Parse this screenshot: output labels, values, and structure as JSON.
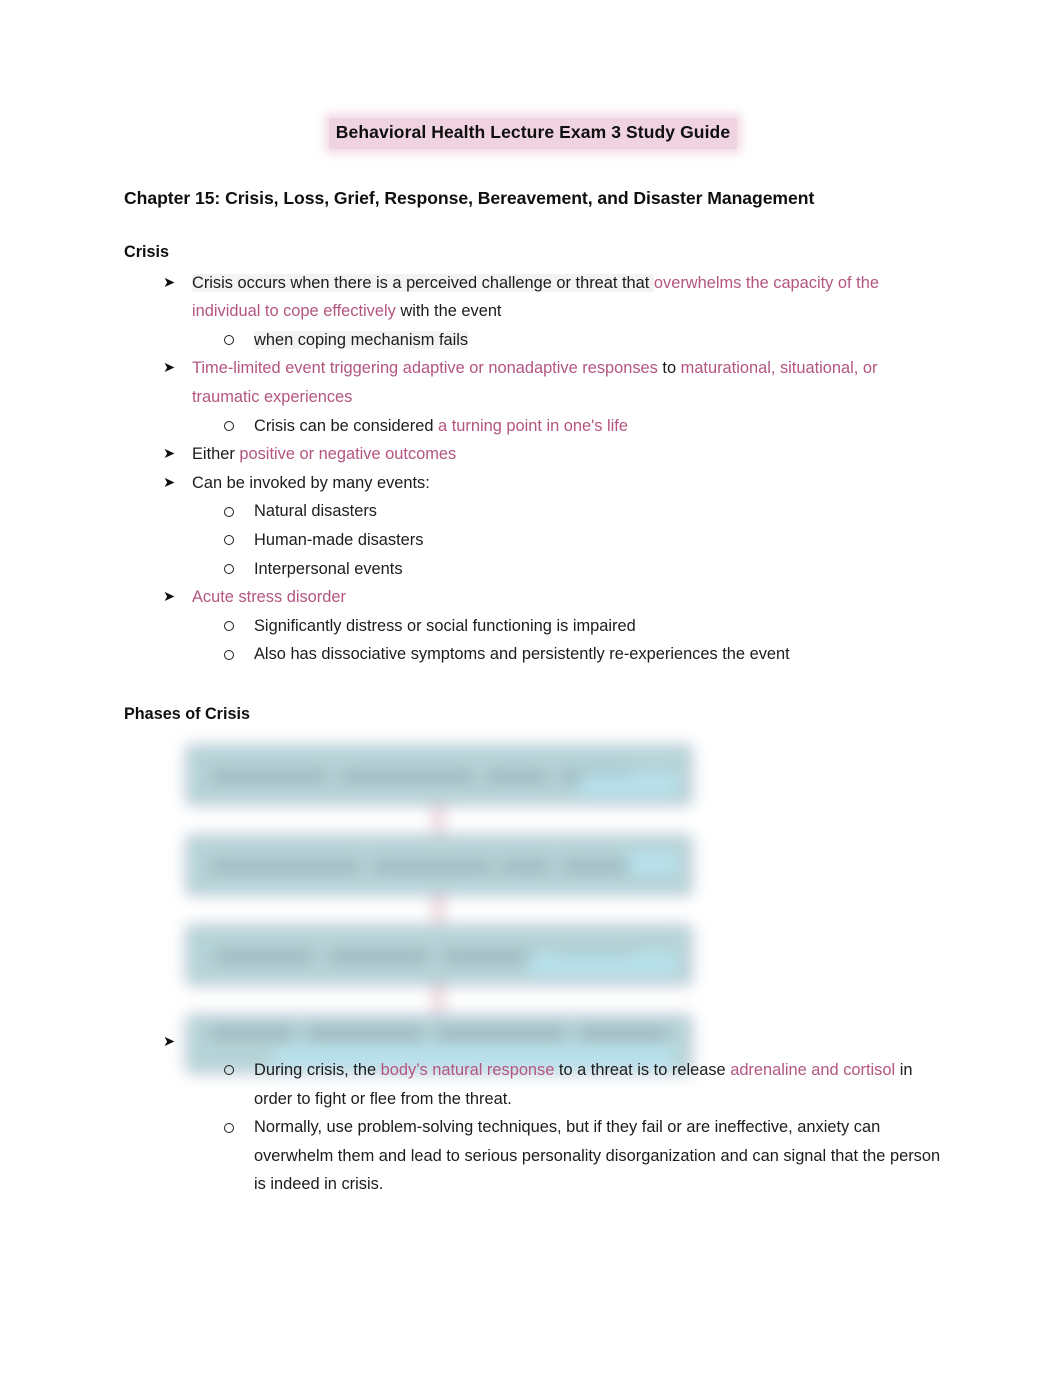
{
  "document": {
    "title": "Behavioral Health Lecture Exam 3 Study Guide",
    "chapter_heading": "Chapter 15: Crisis, Loss, Grief, Response, Bereavement, and Disaster Management"
  },
  "colors": {
    "highlight_pink": "#b35580",
    "title_highlight_bg": "#f0d3e0",
    "diagram_box_fill": "#b3d3d7",
    "diagram_box_border": "#b9bed2",
    "diagram_connector": "#c98c9c",
    "body_text": "#1c1c1c"
  },
  "bullets": {
    "arrow": "➤",
    "circle": "○"
  },
  "sections": [
    {
      "heading": "Crisis",
      "items": [
        {
          "level": 1,
          "runs": [
            {
              "text": "Crisis occurs when there is a perceived challenge or threat that ",
              "style": "dark"
            },
            {
              "text": "overwhelms the capacity of the individual to cope effectively",
              "style": "pink"
            },
            {
              "text": " with the event",
              "style": "dark"
            }
          ]
        },
        {
          "level": 2,
          "runs": [
            {
              "text": "when coping mechanism fails",
              "style": "dark"
            }
          ]
        },
        {
          "level": 1,
          "runs": [
            {
              "text": "Time-limited event triggering adaptive or nonadaptive responses",
              "style": "pink"
            },
            {
              "text": " to",
              "style": "dark"
            },
            {
              "text": " maturational, situational, or traumatic experiences",
              "style": "pink"
            }
          ]
        },
        {
          "level": 2,
          "runs": [
            {
              "text": "Crisis can be considered ",
              "style": "dark"
            },
            {
              "text": "a turning point in one's life",
              "style": "pink"
            }
          ]
        },
        {
          "level": 1,
          "runs": [
            {
              "text": "Either ",
              "style": "dark"
            },
            {
              "text": "positive or negative outcomes",
              "style": "pink"
            }
          ]
        },
        {
          "level": 1,
          "runs": [
            {
              "text": "Can be invoked by many events:",
              "style": "dark"
            }
          ]
        },
        {
          "level": 2,
          "runs": [
            {
              "text": "Natural disasters",
              "style": "dark"
            }
          ]
        },
        {
          "level": 2,
          "runs": [
            {
              "text": "Human-made disasters",
              "style": "dark"
            }
          ]
        },
        {
          "level": 2,
          "runs": [
            {
              "text": "Interpersonal events",
              "style": "dark"
            }
          ]
        },
        {
          "level": 1,
          "runs": [
            {
              "text": "Acute stress disorder",
              "style": "pink"
            }
          ]
        },
        {
          "level": 2,
          "runs": [
            {
              "text": "Significantly distress or social functioning is impaired",
              "style": "dark"
            }
          ]
        },
        {
          "level": 2,
          "runs": [
            {
              "text": "Also has dissociative symptoms and persistently re-experiences the event",
              "style": "dark"
            }
          ]
        }
      ]
    },
    {
      "heading": "Phases of Crisis",
      "figure": {
        "description": "blurred four-step flowchart diagram of the phases of crisis",
        "box_count": 4,
        "connector_count": 3
      },
      "items": [
        {
          "level": 2,
          "runs": [
            {
              "text": "During crisis, the ",
              "style": "dark"
            },
            {
              "text": "body’s natural response",
              "style": "pink"
            },
            {
              "text": " to a threat is to release ",
              "style": "dark"
            },
            {
              "text": "adrenaline and cortisol",
              "style": "pink"
            },
            {
              "text": " in order to fight or flee from the threat.",
              "style": "dark"
            }
          ]
        },
        {
          "level": 2,
          "runs": [
            {
              "text": "Normally, use problem-solving techniques, but if they fail or are ineffective, anxiety can overwhelm them and lead to serious personality disorganization and can signal that the person is indeed in crisis.",
              "style": "dark"
            }
          ]
        }
      ]
    }
  ]
}
